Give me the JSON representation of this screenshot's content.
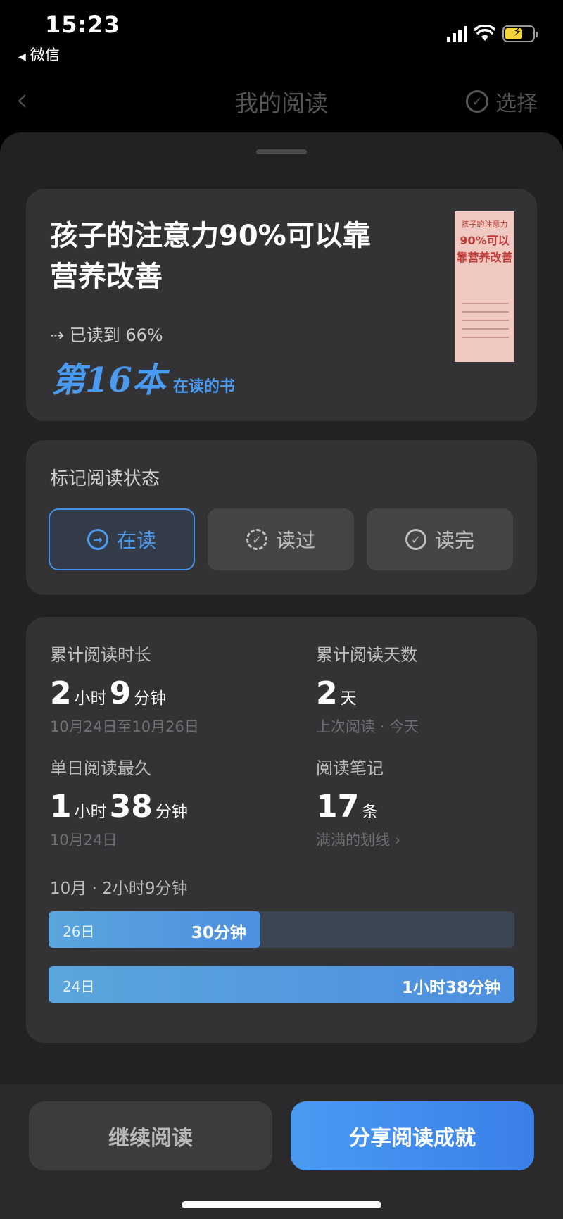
{
  "status_bar": {
    "time": "15:23",
    "back_app": "微信"
  },
  "nav": {
    "back_icon": "chevron-left",
    "title": "我的阅读",
    "select_label": "选择"
  },
  "book": {
    "title": "孩子的注意力90%可以靠营养改善",
    "progress_text": "已读到 66%",
    "rank_number": "第16本",
    "rank_label": "在读的书",
    "cover": {
      "line1": "孩子的注意力",
      "line2": "90%可以靠营养改善"
    }
  },
  "reading_status": {
    "title": "标记阅读状态",
    "options": [
      {
        "label": "在读",
        "icon": "arrow-right-circle",
        "active": true
      },
      {
        "label": "读过",
        "icon": "dashed-check-circle",
        "active": false
      },
      {
        "label": "读完",
        "icon": "check-circle",
        "active": false
      }
    ]
  },
  "stats": {
    "total_time": {
      "label": "累计阅读时长",
      "h": "2",
      "h_unit": "小时",
      "m": "9",
      "m_unit": "分钟",
      "sub": "10月24日至10月26日"
    },
    "total_days": {
      "label": "累计阅读天数",
      "value": "2",
      "unit": "天",
      "sub": "上次阅读 · 今天"
    },
    "max_day": {
      "label": "单日阅读最久",
      "h": "1",
      "h_unit": "小时",
      "m": "38",
      "m_unit": "分钟",
      "sub": "10月24日"
    },
    "notes": {
      "label": "阅读笔记",
      "value": "17",
      "unit": "条",
      "sub": "满满的划线 ›"
    },
    "month_summary": "10月 · 2小时9分钟",
    "daily": [
      {
        "day": "26日",
        "value_text": "30分钟",
        "fraction": 0.4545
      },
      {
        "day": "24日",
        "value_text": "1小时38分钟",
        "fraction": 1.0
      }
    ]
  },
  "actions": {
    "continue": "继续阅读",
    "share": "分享阅读成就"
  },
  "colors": {
    "accent": "#4A9AF0",
    "background": "#222224",
    "card": "#333336"
  }
}
